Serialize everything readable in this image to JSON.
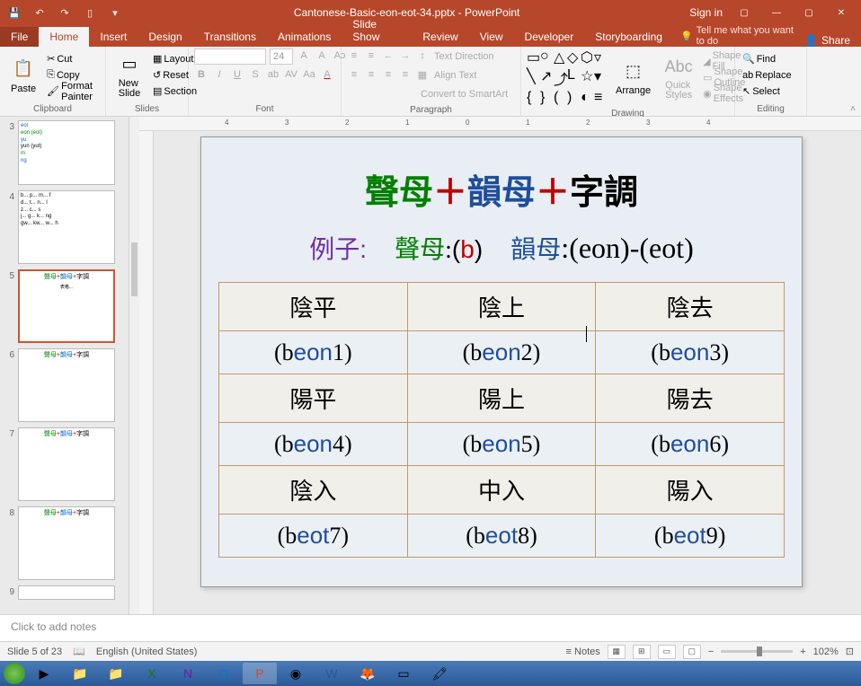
{
  "titlebar": {
    "filename": "Cantonese-Basic-eon-eot-34.pptx - PowerPoint",
    "signin": "Sign in"
  },
  "tabs": {
    "file": "File",
    "home": "Home",
    "insert": "Insert",
    "design": "Design",
    "transitions": "Transitions",
    "animations": "Animations",
    "slideshow": "Slide Show",
    "review": "Review",
    "view": "View",
    "developer": "Developer",
    "storyboarding": "Storyboarding",
    "tellme": "Tell me what you want to do",
    "share": "Share"
  },
  "ribbon": {
    "clipboard": {
      "label": "Clipboard",
      "paste": "Paste",
      "cut": "Cut",
      "copy": "Copy",
      "painter": "Format Painter"
    },
    "slides": {
      "label": "Slides",
      "new": "New\nSlide",
      "layout": "Layout",
      "reset": "Reset",
      "section": "Section"
    },
    "font": {
      "label": "Font",
      "size": "24"
    },
    "paragraph": {
      "label": "Paragraph",
      "textdir": "Text Direction",
      "align": "Align Text",
      "smart": "Convert to SmartArt"
    },
    "drawing": {
      "label": "Drawing",
      "arrange": "Arrange",
      "quick": "Quick\nStyles",
      "fill": "Shape Fill",
      "outline": "Shape Outline",
      "effects": "Shape Effects"
    },
    "editing": {
      "label": "Editing",
      "find": "Find",
      "replace": "Replace",
      "select": "Select"
    }
  },
  "ruler": {
    "marks": [
      "4",
      "3",
      "2",
      "1",
      "0",
      "1",
      "2",
      "3",
      "4"
    ]
  },
  "thumbnails": {
    "items": [
      {
        "num": "3",
        "lines": [
          "eoi",
          "eon (eot)",
          "yu",
          "yun (yut)",
          "m",
          "ng"
        ]
      },
      {
        "num": "4",
        "lines": [
          "b...  p...  m...  f",
          "d...  t...  n...  l",
          "z...  c...  s",
          "j...  g...  k...  ng",
          "gw...  kw...  w...  h"
        ]
      },
      {
        "num": "5",
        "title": "聲母+韻母+字調"
      },
      {
        "num": "6",
        "title": "聲母+韻母+字調"
      },
      {
        "num": "7",
        "title": "聲母+韻母+字調"
      },
      {
        "num": "8",
        "title": "聲母+韻母+字調"
      },
      {
        "num": "9",
        "title": "..."
      }
    ]
  },
  "slide": {
    "title": {
      "p1": "聲母",
      "plus": "＋",
      "p2": "韻母",
      "p3": "字調"
    },
    "sub": {
      "example": "例子:",
      "initial_label": "聲母",
      "initial_val": ":(b)",
      "final_label": "韻母",
      "final_val": ":(eon)-(eot)"
    },
    "table": {
      "r1": [
        "陰平",
        "陰上",
        "陰去"
      ],
      "r2": [
        "(beon1)",
        "(beon2)",
        "(beon3)"
      ],
      "r3": [
        "陽平",
        "陽上",
        "陽去"
      ],
      "r4": [
        "(beon4)",
        "(beon5)",
        "(beon6)"
      ],
      "r5": [
        "陰入",
        "中入",
        "陽入"
      ],
      "r6": [
        "(beot7)",
        "(beot8)",
        "(beot9)"
      ]
    }
  },
  "notes": {
    "placeholder": "Click to add notes"
  },
  "status": {
    "slide": "Slide 5 of 23",
    "lang": "English (United States)",
    "notes": "Notes",
    "zoom": "102%"
  }
}
